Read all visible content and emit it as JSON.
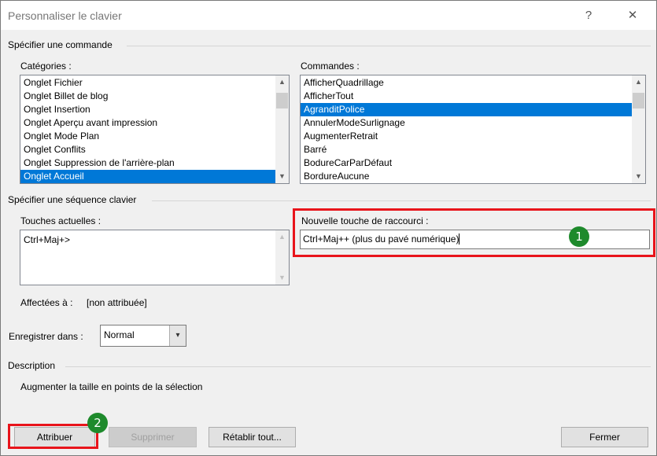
{
  "window": {
    "title": "Personnaliser le clavier",
    "help_label": "?",
    "close_label": "✕"
  },
  "command_group": {
    "title": "Spécifier une commande",
    "categories_label": "Catégories :",
    "commands_label": "Commandes :",
    "categories": [
      {
        "label": "Onglet Fichier",
        "selected": false
      },
      {
        "label": "Onglet Billet de blog",
        "selected": false
      },
      {
        "label": "Onglet Insertion",
        "selected": false
      },
      {
        "label": "Onglet Aperçu avant impression",
        "selected": false
      },
      {
        "label": "Onglet Mode Plan",
        "selected": false
      },
      {
        "label": "Onglet Conflits",
        "selected": false
      },
      {
        "label": "Onglet Suppression de l'arrière-plan",
        "selected": false
      },
      {
        "label": "Onglet Accueil",
        "selected": true
      }
    ],
    "commands": [
      {
        "label": "AfficherQuadrillage",
        "selected": false
      },
      {
        "label": "AfficherTout",
        "selected": false
      },
      {
        "label": "AgranditPolice",
        "selected": true
      },
      {
        "label": "AnnulerModeSurlignage",
        "selected": false
      },
      {
        "label": "AugmenterRetrait",
        "selected": false
      },
      {
        "label": "Barré",
        "selected": false
      },
      {
        "label": "BodureCarParDéfaut",
        "selected": false
      },
      {
        "label": "BordureAucune",
        "selected": false
      }
    ]
  },
  "keyboard_group": {
    "title": "Spécifier une séquence clavier",
    "current_keys_label": "Touches actuelles :",
    "current_keys": [
      "Ctrl+Maj+>"
    ],
    "new_shortcut_label": "Nouvelle touche de raccourci :",
    "new_shortcut_value": "Ctrl+Maj++ (plus du pavé numérique)",
    "assigned_label": "Affectées à :",
    "assigned_value": "[non attribuée]"
  },
  "save_in": {
    "label": "Enregistrer dans :",
    "value": "Normal"
  },
  "description": {
    "title": "Description",
    "text": "Augmenter la taille en points de la sélection"
  },
  "buttons": {
    "assign": "Attribuer",
    "remove": "Supprimer",
    "reset_all": "Rétablir tout...",
    "close": "Fermer"
  },
  "annotations": {
    "badge_1": "1",
    "badge_2": "2",
    "highlight_color": "#e8141b",
    "badge_color": "#1e8a2c"
  },
  "icons": {
    "scroll_up": "▲",
    "scroll_down": "▼",
    "combo_arrow": "▾"
  }
}
